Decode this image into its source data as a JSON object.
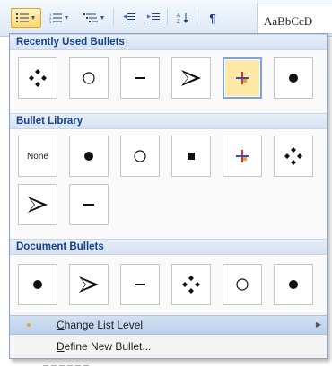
{
  "ribbon": {
    "buttons": [
      {
        "name": "bullets-button",
        "icon": "bullets-icon",
        "has_dropdown": true,
        "active": true
      },
      {
        "name": "numbering-button",
        "icon": "numbering-icon",
        "has_dropdown": true,
        "active": false
      },
      {
        "name": "multilevel-list-button",
        "icon": "multilevel-list-icon",
        "has_dropdown": true,
        "active": false
      },
      {
        "name": "decrease-indent-button",
        "icon": "decrease-indent-icon",
        "has_dropdown": false,
        "active": false
      },
      {
        "name": "increase-indent-button",
        "icon": "increase-indent-icon",
        "has_dropdown": false,
        "active": false
      },
      {
        "name": "sort-button",
        "icon": "sort-az-icon",
        "has_dropdown": false,
        "active": false
      },
      {
        "name": "show-formatting-button",
        "icon": "pilcrow-icon",
        "has_dropdown": false,
        "active": false
      }
    ],
    "style_preview": "AaBbCcD"
  },
  "sections": {
    "recent": {
      "title": "Recently Used Bullets",
      "bullets": [
        "four-diamond",
        "circle-outline",
        "dash",
        "arrowhead",
        "colored-cross",
        "filled-dot"
      ],
      "selected_index": 4
    },
    "library": {
      "title": "Bullet Library",
      "none_label": "None",
      "bullets": [
        "none",
        "filled-dot",
        "circle-outline",
        "filled-square",
        "colored-cross",
        "four-diamond",
        "arrowhead",
        "dash"
      ]
    },
    "document": {
      "title": "Document Bullets",
      "bullets": [
        "filled-dot",
        "arrowhead",
        "dash",
        "four-diamond",
        "circle-outline",
        "filled-dot"
      ]
    }
  },
  "menu": {
    "change_level": {
      "access_key": "C",
      "rest": "hange List Level"
    },
    "define_new": {
      "access_key": "D",
      "rest": "efine New Bullet..."
    }
  },
  "colors": {
    "section_header_text": "#15428b",
    "selected_tile_bg": "#fde9a3",
    "selected_tile_border": "#7aa5e0",
    "cross_red": "#e03030",
    "cross_blue": "#3050c0",
    "cross_orange": "#f0a030"
  }
}
